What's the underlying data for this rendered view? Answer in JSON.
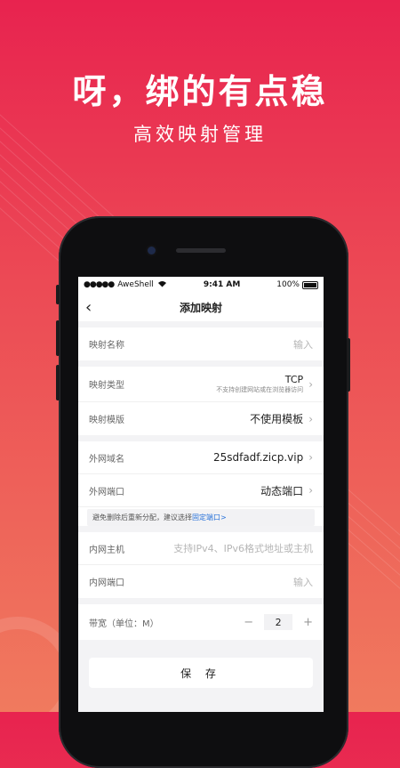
{
  "hero": {
    "headline": "呀，绑的有点稳",
    "subline": "高效映射管理"
  },
  "status_bar": {
    "carrier": "AweShell",
    "time": "9:41 AM",
    "battery": "100%"
  },
  "nav": {
    "title": "添加映射"
  },
  "form": {
    "name": {
      "label": "映射名称",
      "placeholder": "输入"
    },
    "type": {
      "label": "映射类型",
      "value": "TCP",
      "hint": "不支持创建网站或在浏览器访问"
    },
    "template": {
      "label": "映射模版",
      "value": "不使用模板"
    },
    "domain": {
      "label": "外网域名",
      "value": "25sdfadf.zicp.vip"
    },
    "ext_port": {
      "label": "外网端口",
      "value": "动态端口"
    },
    "tip": {
      "text": "避免删除后重新分配，建议选择",
      "link": "固定端口>"
    },
    "host": {
      "label": "内网主机",
      "placeholder": "支持IPv4、IPv6格式地址或主机"
    },
    "int_port": {
      "label": "内网端口",
      "placeholder": "输入"
    },
    "bandwidth": {
      "label": "带宽（单位：M）",
      "value": "2",
      "minus": "−",
      "plus": "+"
    },
    "save_label": "保 存"
  }
}
